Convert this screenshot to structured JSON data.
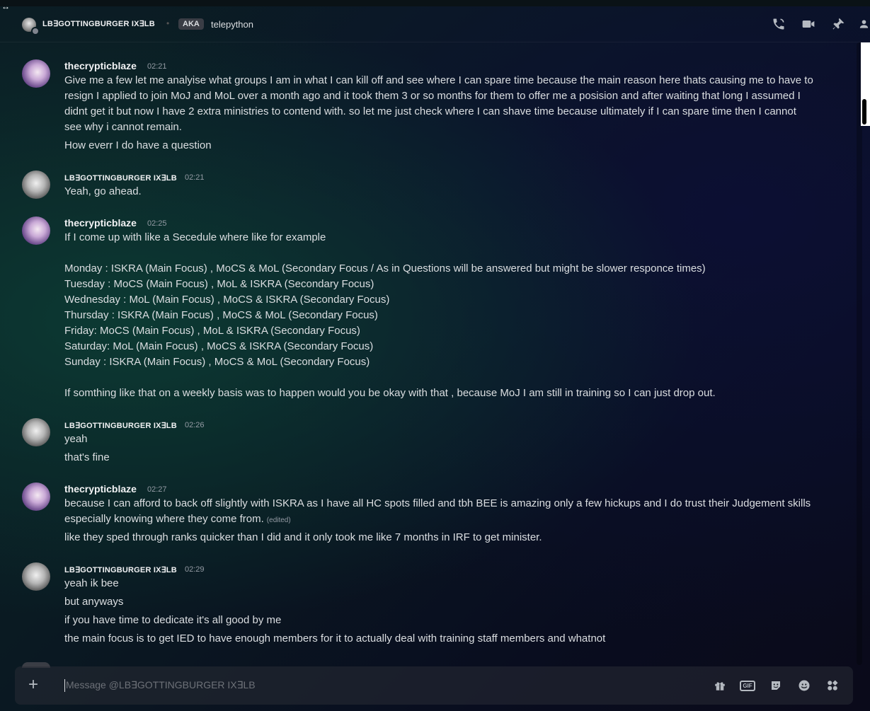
{
  "header": {
    "dm_name": "LB∃GOTTINGBURGER IX∃LB",
    "aka_badge": "AKA",
    "aka_name": "telepython",
    "icons": [
      "phone-call-icon",
      "video-camera-icon",
      "pin-icon",
      "people-icon"
    ]
  },
  "messages": [
    {
      "author": "thecrypticblaze",
      "time": "02:21",
      "lines": [
        "Give me a few let me analyise what groups I am in what I can kill off and see where I can spare time because the main reason here thats causing me to have to",
        "resign I applied to join MoJ and MoL over a month ago and it took them 3 or so months for them to offer me a posision and after waiting that long I assumed I",
        "didnt get it but now I have 2 extra ministries to contend with. so let me just check where I can shave time because ultimately if I can spare time then I cannot",
        "see why i cannot remain.",
        "How everr I do have a question"
      ]
    },
    {
      "author": "LB∃GOTTINGBURGER IX∃LB",
      "time": "02:21",
      "lines": [
        "Yeah, go ahead."
      ]
    },
    {
      "author": "thecrypticblaze",
      "time": "02:25",
      "lines": [
        "If I come up with like a Secedule where like for example",
        "Monday : ISKRA (Main Focus) , MoCS & MoL (Secondary Focus / As in Questions will be answered but might be slower responce times)",
        "Tuesday : MoCS (Main Focus) , MoL & ISKRA (Secondary Focus)",
        "Wednesday : MoL (Main Focus) , MoCS & ISKRA (Secondary Focus)",
        "Thursday : ISKRA (Main Focus) , MoCS & MoL (Secondary Focus)",
        "Friday: MoCS (Main Focus) , MoL & ISKRA (Secondary Focus)",
        "Saturday: MoL (Main Focus) , MoCS & ISKRA (Secondary Focus)",
        "Sunday : ISKRA (Main Focus) , MoCS & MoL (Secondary Focus)",
        "If somthing like that on a weekly basis was to happen would you be okay with that , because MoJ I am still in training so I can just drop out."
      ]
    },
    {
      "author": "LB∃GOTTINGBURGER IX∃LB",
      "time": "02:26",
      "lines": [
        "yeah",
        "that's fine"
      ]
    },
    {
      "author": "thecrypticblaze",
      "time": "02:27",
      "lines": [
        "because I can afford to back off slightly with ISKRA as I have all HC spots filled and tbh BEE is amazing only a few hickups and I do trust their Judgement skills",
        "especially knowing where they come from.",
        "like they sped through ranks quicker than I did and it only took me like 7 months in IRF to get minister."
      ],
      "edited": "(edited)"
    },
    {
      "author": "LB∃GOTTINGBURGER IX∃LB",
      "time": "02:29",
      "lines": [
        "yeah ik bee",
        "but anyways",
        "if you have time to dedicate it's all good by me",
        "the main focus is to get IED to have enough members for it to actually deal with training staff members and whatnot"
      ]
    }
  ],
  "composer": {
    "placeholder": "Message @LB∃GOTTINGBURGER IX∃LB",
    "icons": [
      "add-icon",
      "gift-icon",
      "gif-icon",
      "sticker-icon",
      "emoji-icon",
      "apps-icon"
    ],
    "gif_label": "GIF"
  }
}
